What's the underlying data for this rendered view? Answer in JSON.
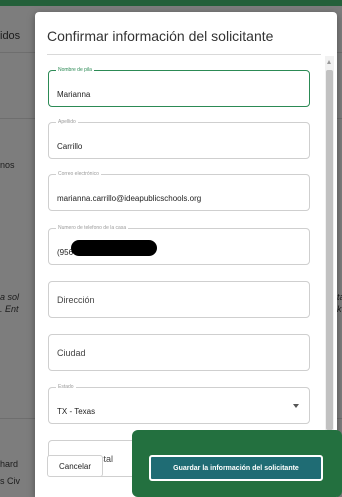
{
  "background": {
    "partial_texts": {
      "top_left": "idos",
      "mid_left": "nos",
      "left_a": "a sol",
      "left_b": ". Ent",
      "right_a": "ta",
      "right_b": "k",
      "bottom_left_a": "hard",
      "bottom_left_b": "s Civ"
    }
  },
  "modal": {
    "title": "Confirmar información del solicitante",
    "fields": {
      "first_name": {
        "label": "Nombre de pila",
        "value": "Marianna"
      },
      "last_name": {
        "label": "Apellido",
        "value": "Carrillo"
      },
      "email": {
        "label": "Correo electrónico",
        "value": "marianna.carrillo@ideapublicschools.org"
      },
      "home_phone": {
        "label": "Numero de telefono de la casa",
        "value": "(956"
      },
      "address": {
        "placeholder": "Dirección"
      },
      "city": {
        "placeholder": "Ciudad"
      },
      "state": {
        "label": "Estado",
        "value": "TX - Texas"
      },
      "postal_code": {
        "placeholder": "Código Postal"
      }
    },
    "buttons": {
      "cancel": "Cancelar",
      "save": "Guardar la información del solicitante"
    }
  },
  "colors": {
    "accent_green": "#2c8a55",
    "highlight_green": "#23703f",
    "save_button": "#1f6c74"
  }
}
